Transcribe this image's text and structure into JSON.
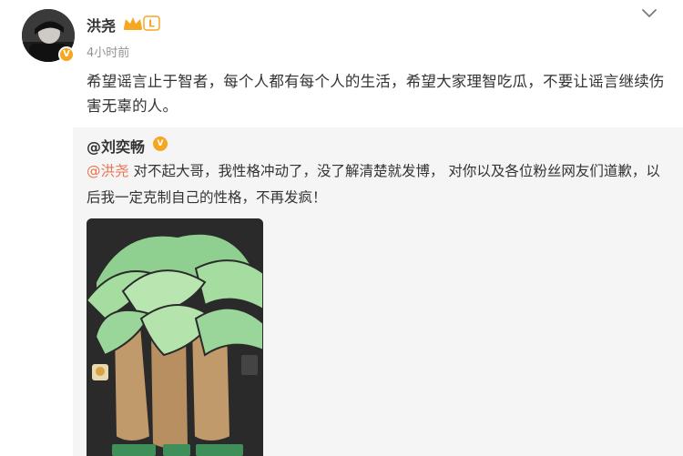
{
  "post": {
    "author_name": "洪尧",
    "vip_level": "L",
    "timestamp": "4小时前",
    "text": "希望谣言止于智者，每个人都有每个人的生活，希望大家理智吃瓜，不要让谣言继续伤害无辜的人。",
    "colors": {
      "accent": "#eb7350",
      "verified": "#f5a623",
      "vip": "#f5a623",
      "repost_bg": "#f5f5f5"
    }
  },
  "repost": {
    "author": "@刘奕畅",
    "mention": "@洪尧",
    "text_rest": " 对不起大哥，我性格冲动了，没了解清楚就发博， 对你以及各位粉丝网友们道歉，以后我一定克制自己的性格，不再发疯！"
  },
  "icons": {
    "chevron": "chevron-down-icon",
    "verified": "verified-badge-icon",
    "vip": "vip-crown-icon"
  }
}
